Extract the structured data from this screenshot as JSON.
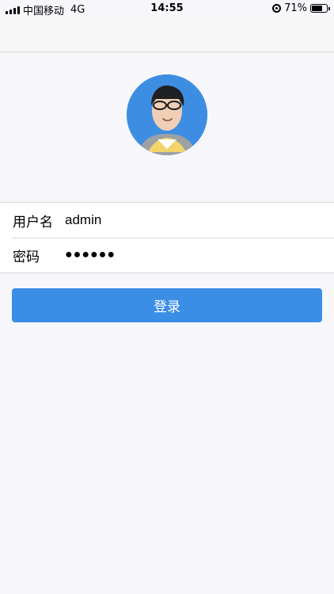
{
  "status_bar": {
    "carrier": "中国移动",
    "network": "4G",
    "time": "14:55",
    "battery_percent": "71%",
    "battery_level": 0.71
  },
  "login_form": {
    "username_label": "用户名",
    "username_value": "admin",
    "password_label": "密码",
    "password_value": "●●●●●●",
    "login_button_label": "登录"
  },
  "colors": {
    "primary": "#3a8ee6",
    "background": "#f7f7fb",
    "avatar_bg": "#3d8ee3"
  },
  "icons": {
    "signal": "signal-icon",
    "rotation_lock": "rotation-lock-icon",
    "battery": "battery-icon"
  }
}
